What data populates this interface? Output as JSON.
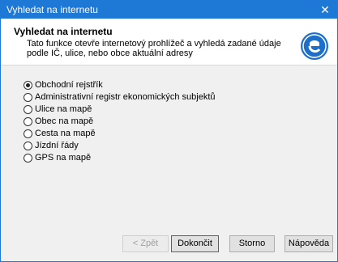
{
  "window": {
    "title": "Vyhledat na internetu",
    "close_glyph": "✕"
  },
  "header": {
    "title": "Vyhledat na internetu",
    "description": "Tato funkce otevře internetový prohlížeč a vyhledá zadané údaje podle IČ, ulice, nebo obce aktuální adresy",
    "logo_icon": "internet-explorer-logo"
  },
  "options": [
    {
      "label": "Obchodní rejstřík",
      "selected": true
    },
    {
      "label": "Administrativní registr ekonomických subjektů",
      "selected": false
    },
    {
      "label": "Ulice na mapě",
      "selected": false
    },
    {
      "label": "Obec na mapě",
      "selected": false
    },
    {
      "label": "Cesta na mapě",
      "selected": false
    },
    {
      "label": "Jízdní řády",
      "selected": false
    },
    {
      "label": "GPS na mapě",
      "selected": false
    }
  ],
  "buttons": {
    "back": "< Zpět",
    "finish": "Dokončit",
    "cancel": "Storno",
    "help": "Nápověda"
  },
  "colors": {
    "titlebar": "#1e78d6",
    "logo": "#1e6fc9"
  }
}
